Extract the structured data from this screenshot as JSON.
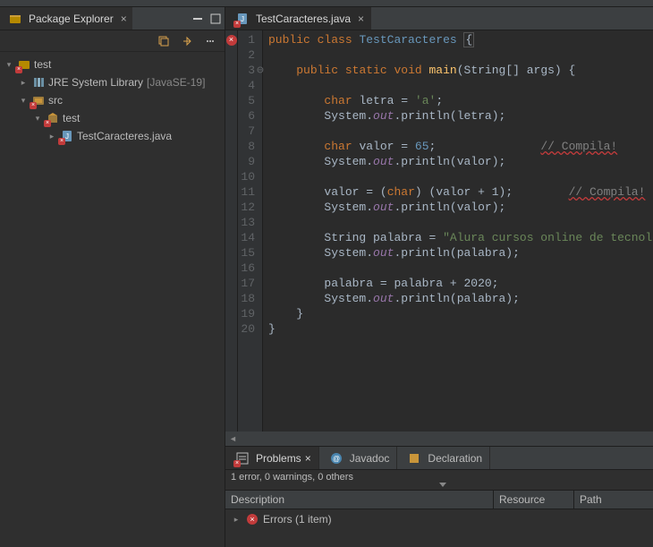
{
  "explorer": {
    "title": "Package Explorer",
    "tree": {
      "root": "test",
      "jre": "JRE System Library",
      "jre_suffix": "[JavaSE-19]",
      "src": "src",
      "pkg": "test",
      "file": "TestCaracteres.java"
    }
  },
  "editor": {
    "tab": "TestCaracteres.java",
    "lines": [
      1,
      2,
      3,
      4,
      5,
      6,
      7,
      8,
      9,
      10,
      11,
      12,
      13,
      14,
      15,
      16,
      17,
      18,
      19,
      20
    ],
    "code": {
      "l1_kw1": "public",
      "l1_kw2": "class",
      "l1_cls": "TestCaracteres",
      "l1_brace": "{",
      "l3_kw1": "public",
      "l3_kw2": "static",
      "l3_kw3": "void",
      "l3_mtd": "main",
      "l3_sig": "(String[] args) {",
      "l5_kw": "char",
      "l5_id": "letra",
      "l5_eq": "=",
      "l5_chr": "'a'",
      "l5_semi": ";",
      "l6_sys": "System",
      "l6_out": "out",
      "l6_pr": "println",
      "l6_arg": "letra",
      "l8_kw": "char",
      "l8_id": "valor",
      "l8_eq": "=",
      "l8_num": "65",
      "l8_cmt": "// Compila!",
      "l9_sys": "System",
      "l9_out": "out",
      "l9_pr": "println",
      "l9_arg": "valor",
      "l11_id": "valor",
      "l11_eq": "=",
      "l11_cast": "char",
      "l11_expr": "(valor + 1);",
      "l11_cmt": "// Compila!",
      "l12_sys": "System",
      "l12_out": "out",
      "l12_pr": "println",
      "l12_arg": "valor",
      "l14_kw": "String",
      "l14_id": "palabra",
      "l14_eq": "=",
      "l14_str": "\"Alura cursos online de tecnología\"",
      "l14_semi": ";",
      "l15_sys": "System",
      "l15_out": "out",
      "l15_pr": "println",
      "l15_arg": "palabra",
      "l17_id": "palabra",
      "l17_eq": "=",
      "l17_expr": "palabra + 2020;",
      "l18_sys": "System",
      "l18_out": "out",
      "l18_pr": "println",
      "l18_arg": "palabra"
    }
  },
  "bottom": {
    "tabs": {
      "problems": "Problems",
      "javadoc": "Javadoc",
      "decl": "Declaration"
    },
    "status": "1 error, 0 warnings, 0 others",
    "cols": {
      "desc": "Description",
      "res": "Resource",
      "path": "Path"
    },
    "row": "Errors (1 item)"
  }
}
